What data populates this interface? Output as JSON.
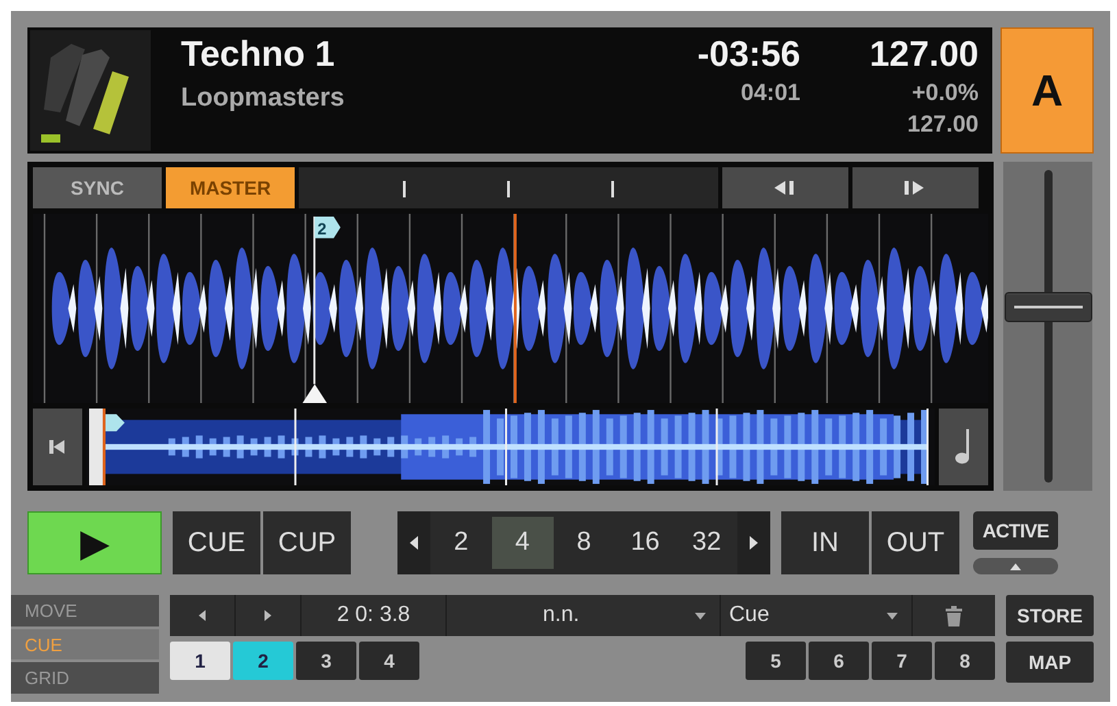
{
  "deck": {
    "title": "Techno 1",
    "artist": "Loopmasters",
    "remaining_time": "-03:56",
    "total_time": "04:01",
    "bpm": "127.00",
    "pitch": "+0.0%",
    "base_bpm": "127.00",
    "letter": "A"
  },
  "sync": {
    "label": "SYNC",
    "on": false
  },
  "master": {
    "label": "MASTER",
    "on": true
  },
  "waveform": {
    "cue_label": "2"
  },
  "tempo_fader": {
    "level": 0.56
  },
  "play": {
    "label": "▶",
    "on": true
  },
  "cue_buttons": [
    "CUE",
    "CUP"
  ],
  "loop_sizes": [
    {
      "label": "2",
      "selected": false
    },
    {
      "label": "4",
      "selected": true
    },
    {
      "label": "8",
      "selected": false
    },
    {
      "label": "16",
      "selected": false
    },
    {
      "label": "32",
      "selected": false
    }
  ],
  "loop_buttons": [
    "IN",
    "OUT"
  ],
  "active": {
    "label": "ACTIVE"
  },
  "modes": [
    {
      "label": "MOVE",
      "selected": false
    },
    {
      "label": "CUE",
      "selected": true
    },
    {
      "label": "GRID",
      "selected": false
    }
  ],
  "cue_row": {
    "position": "2 0: 3.8",
    "name": "n.n.",
    "type": "Cue",
    "store": "STORE",
    "map": "MAP"
  },
  "hotcues": [
    {
      "label": "1",
      "color": "#e4e4e4"
    },
    {
      "label": "2",
      "color": "#25c9d6"
    },
    {
      "label": "3",
      "color": "#2a2a2a"
    },
    {
      "label": "4",
      "color": "#2a2a2a"
    },
    {
      "label": "5",
      "color": "#2a2a2a"
    },
    {
      "label": "6",
      "color": "#2a2a2a"
    },
    {
      "label": "7",
      "color": "#2a2a2a"
    },
    {
      "label": "8",
      "color": "#2a2a2a"
    }
  ]
}
